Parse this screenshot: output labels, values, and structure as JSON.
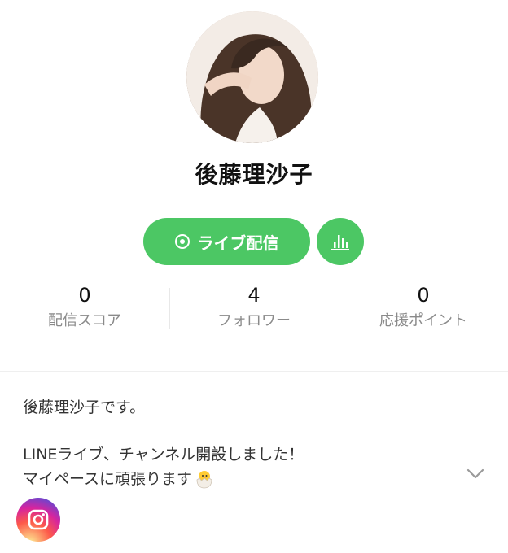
{
  "profile": {
    "name": "後藤理沙子",
    "live_button_label": "ライブ配信"
  },
  "stats": [
    {
      "value": "0",
      "label": "配信スコア"
    },
    {
      "value": "4",
      "label": "フォロワー"
    },
    {
      "value": "0",
      "label": "応援ポイント"
    }
  ],
  "bio": {
    "line1": "後藤理沙子です。",
    "line2": "LINEライブ、チャンネル開設しました！",
    "line3": "マイペースに頑張ります"
  },
  "icons": {
    "live": "live-broadcast-icon",
    "stats": "bar-chart-icon",
    "expand": "chevron-down-icon",
    "instagram": "instagram-icon",
    "emoji": "hatching-chick-icon"
  },
  "colors": {
    "accent": "#4cc764",
    "label_gray": "#8a8a8a"
  }
}
